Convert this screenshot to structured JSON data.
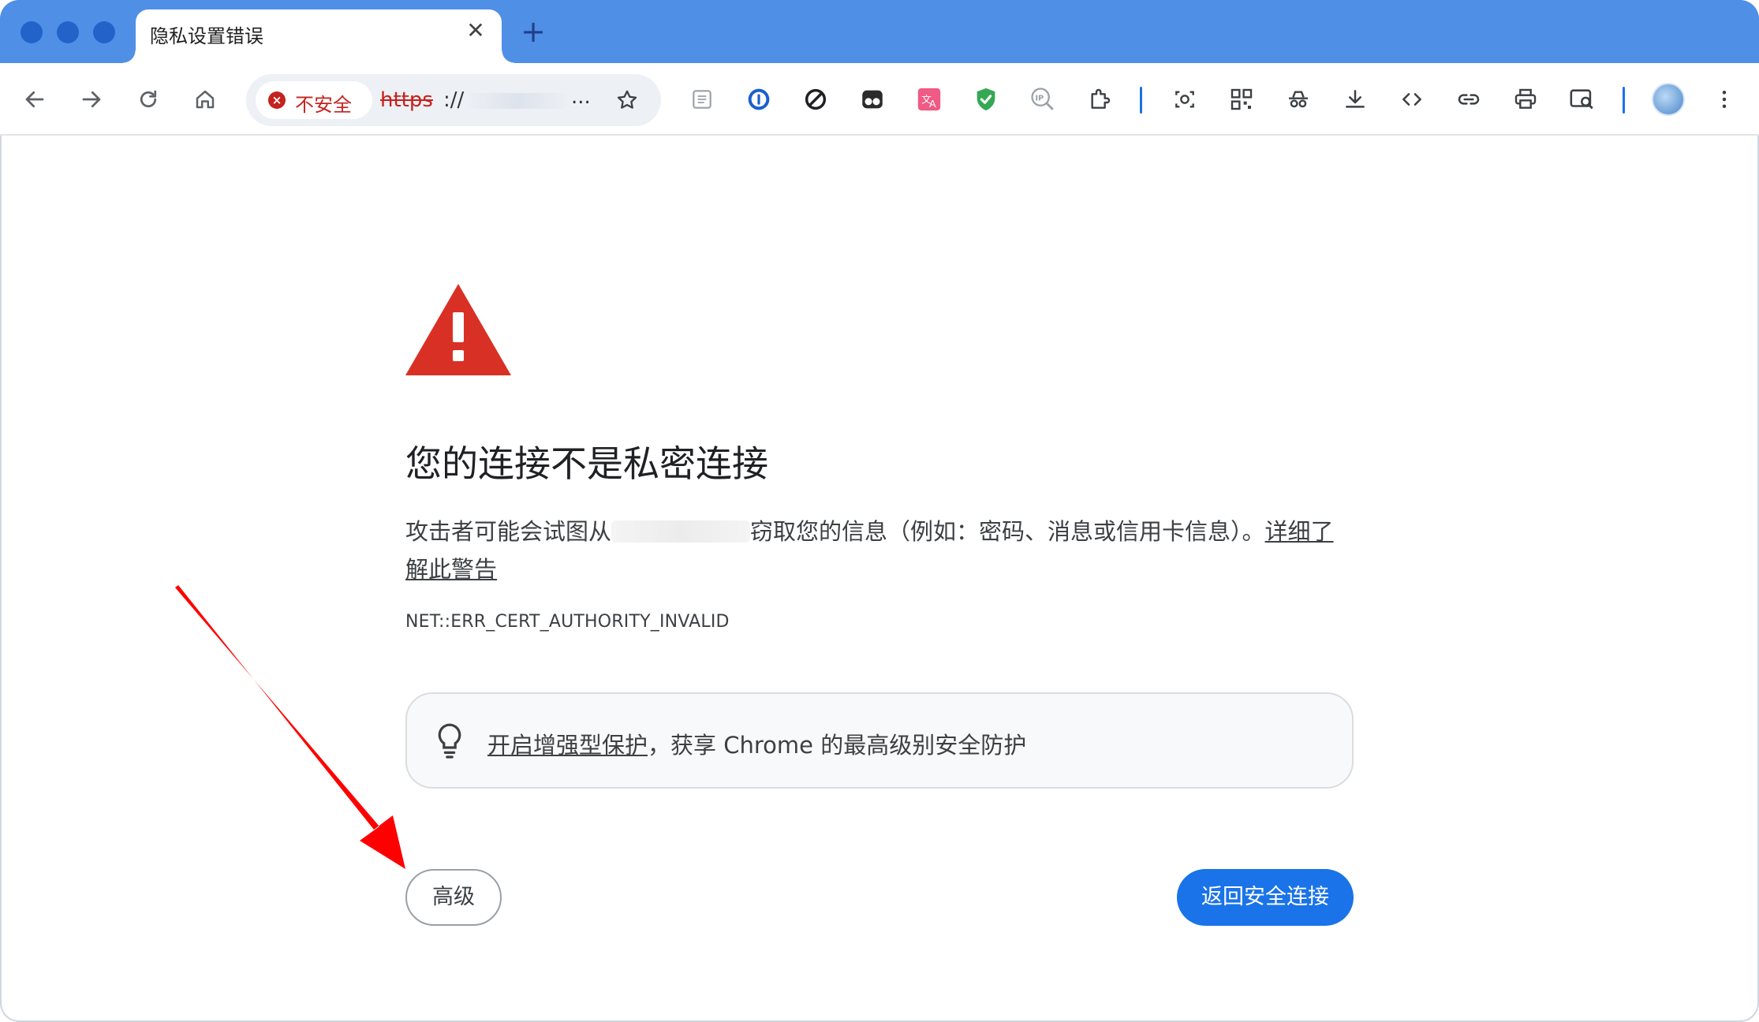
{
  "tab": {
    "title": "隐私设置错误",
    "close_glyph": "✕",
    "new_tab_glyph": "+"
  },
  "omnibox": {
    "security_chip_label": "不安全",
    "scheme": "https",
    "separator": "://",
    "ellipsis": "..."
  },
  "page": {
    "heading": "您的连接不是私密连接",
    "description_before": "攻击者可能会试图从",
    "description_after": "窃取您的信息（例如：密码、消息或信用卡信息）。",
    "learn_more": "详细了解此警告",
    "error_code": "NET::ERR_CERT_AUTHORITY_INVALID",
    "promo_link": "开启增强型保护",
    "promo_rest": "，获享 Chrome 的最高级别安全防护",
    "advanced_button": "高级",
    "back_button": "返回安全连接"
  },
  "colors": {
    "tabstrip": "#4f8fe6",
    "danger": "#c5221f",
    "warning_triangle": "#d93025",
    "primary_button": "#1a73e8",
    "annotation_arrow": "#ff0000"
  },
  "icons": {
    "toolbar": [
      "back-arrow-icon",
      "forward-arrow-icon",
      "reload-icon",
      "home-icon",
      "bookmark-star-icon"
    ],
    "extensions": [
      "reader-mode-icon",
      "password-manager-icon",
      "block-icon",
      "incognito-glasses-icon",
      "translate-icon",
      "shield-check-icon",
      "ip-lookup-icon",
      "puzzle-extensions-icon",
      "screenshot-icon",
      "qr-code-icon",
      "spy-icon",
      "download-icon",
      "code-view-icon",
      "link-icon",
      "print-icon",
      "search-page-icon"
    ],
    "menu": "more-vertical-icon"
  }
}
